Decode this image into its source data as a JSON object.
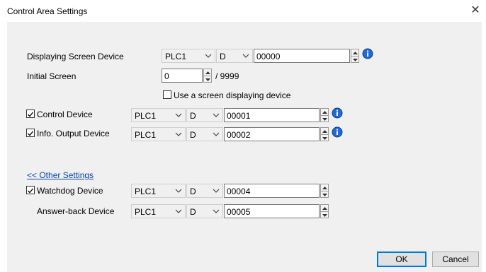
{
  "window": {
    "title": "Control Area Settings"
  },
  "rows": {
    "display": {
      "label": "Displaying Screen Device",
      "plc": "PLC1",
      "device": "D",
      "address": "00000"
    },
    "initial": {
      "label": "Initial Screen",
      "value": "0",
      "suffix": "/ 9999"
    },
    "use_screen": {
      "label": "Use a screen displaying device",
      "checked": false
    },
    "control": {
      "label": "Control Device",
      "checked": true,
      "plc": "PLC1",
      "device": "D",
      "address": "00001"
    },
    "info_output": {
      "label": "Info. Output Device",
      "checked": true,
      "plc": "PLC1",
      "device": "D",
      "address": "00002"
    },
    "other_settings": {
      "label": "<< Other Settings"
    },
    "watchdog": {
      "label": "Watchdog Device",
      "checked": true,
      "plc": "PLC1",
      "device": "D",
      "address": "00004"
    },
    "answer_back": {
      "label": "Answer-back Device",
      "plc": "PLC1",
      "device": "D",
      "address": "00005"
    }
  },
  "buttons": {
    "ok": "OK",
    "cancel": "Cancel"
  },
  "icons": {
    "close": "close-icon",
    "chevron": "chevron-down-icon",
    "info": "info-icon",
    "spin": "spin-updown-icon",
    "check": "check-icon"
  },
  "colors": {
    "link": "#0645ad",
    "info_blue": "#1e6bd6",
    "dialog_bg": "#f0f0f0",
    "default_button_border": "#0078d7"
  }
}
